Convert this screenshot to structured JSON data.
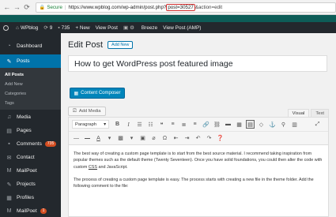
{
  "browser": {
    "secure_label": "Secure",
    "url_start": "https://www.wpblog.com/wp-admin/post.php?",
    "url_highlight": "post=30527",
    "url_end": "&action=edit"
  },
  "admin_bar": {
    "site_name": "WPblog",
    "updates_count": "9",
    "comments_count": "735",
    "new_label": "+ New",
    "view_post": "View Post",
    "breeze": "Breeze",
    "view_post_amp": "View Post (AMP)",
    "icons": [
      "wordpress-icon",
      "home-icon",
      "updates-icon",
      "comments-icon",
      "plus-icon",
      "view-icon"
    ]
  },
  "sidebar": {
    "dashboard": "Dashboard",
    "posts": "Posts",
    "submenu": [
      "All Posts",
      "Add New",
      "Categories",
      "Tags"
    ],
    "items": [
      "Media",
      "Pages",
      "Comments",
      "Contact",
      "MailPoet",
      "Projects",
      "Profiles",
      "MailPoet"
    ],
    "comments_badge": "735",
    "mailpoet_badge": "1"
  },
  "main": {
    "page_title": "Edit Post",
    "add_new": "Add New",
    "post_title": "How to get WordPress post featured image",
    "composer_button": "Content Composer",
    "add_media": "Add Media",
    "tab_visual": "Visual",
    "tab_text": "Text",
    "format_select": "Paragraph",
    "format_arrow": "▾",
    "paragraph1_a": "The best way of creating a custom page template is to start from the best source material. I recommend taking inspiration from popular themes such as the default theme (Twenty Seventeen). Once you have solid foundations, you could then alter the code with custom ",
    "paragraph1_css": "CSS",
    "paragraph1_b": " and JavaScript.",
    "paragraph2": "The process of creating a custom page template is easy. The process starts with creating a new file in the theme folder. Add the following comment to the file:"
  },
  "colors": {
    "admin_dark": "#23282d",
    "accent_blue": "#0073aa",
    "band_teal": "#0d5c57",
    "badge_orange": "#d54e21",
    "url_highlight_border": "#d32f2f"
  }
}
